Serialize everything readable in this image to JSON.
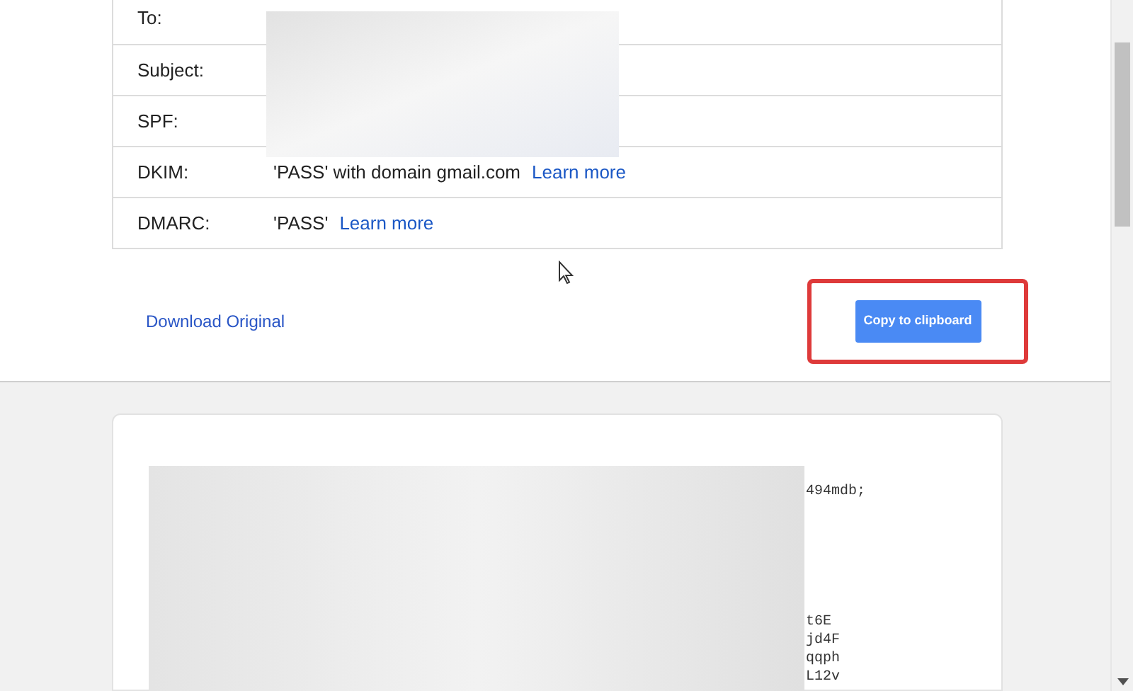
{
  "headers": [
    {
      "label": "To:"
    },
    {
      "label": "Subject:"
    },
    {
      "label": "SPF:"
    },
    {
      "label": "DKIM:",
      "value": "'PASS' with domain gmail.com",
      "link": "Learn more"
    },
    {
      "label": "DMARC:",
      "value": "'PASS'",
      "link": "Learn more"
    }
  ],
  "download_link": "Download Original",
  "copy_button": {
    "label": "Copy to clipboard",
    "highlighted": true
  },
  "code": {
    "lines_top": [
      "494mdb;"
    ],
    "lines_bottom": [
      "t6E",
      "jd4F",
      "qqph",
      "L12v"
    ]
  }
}
